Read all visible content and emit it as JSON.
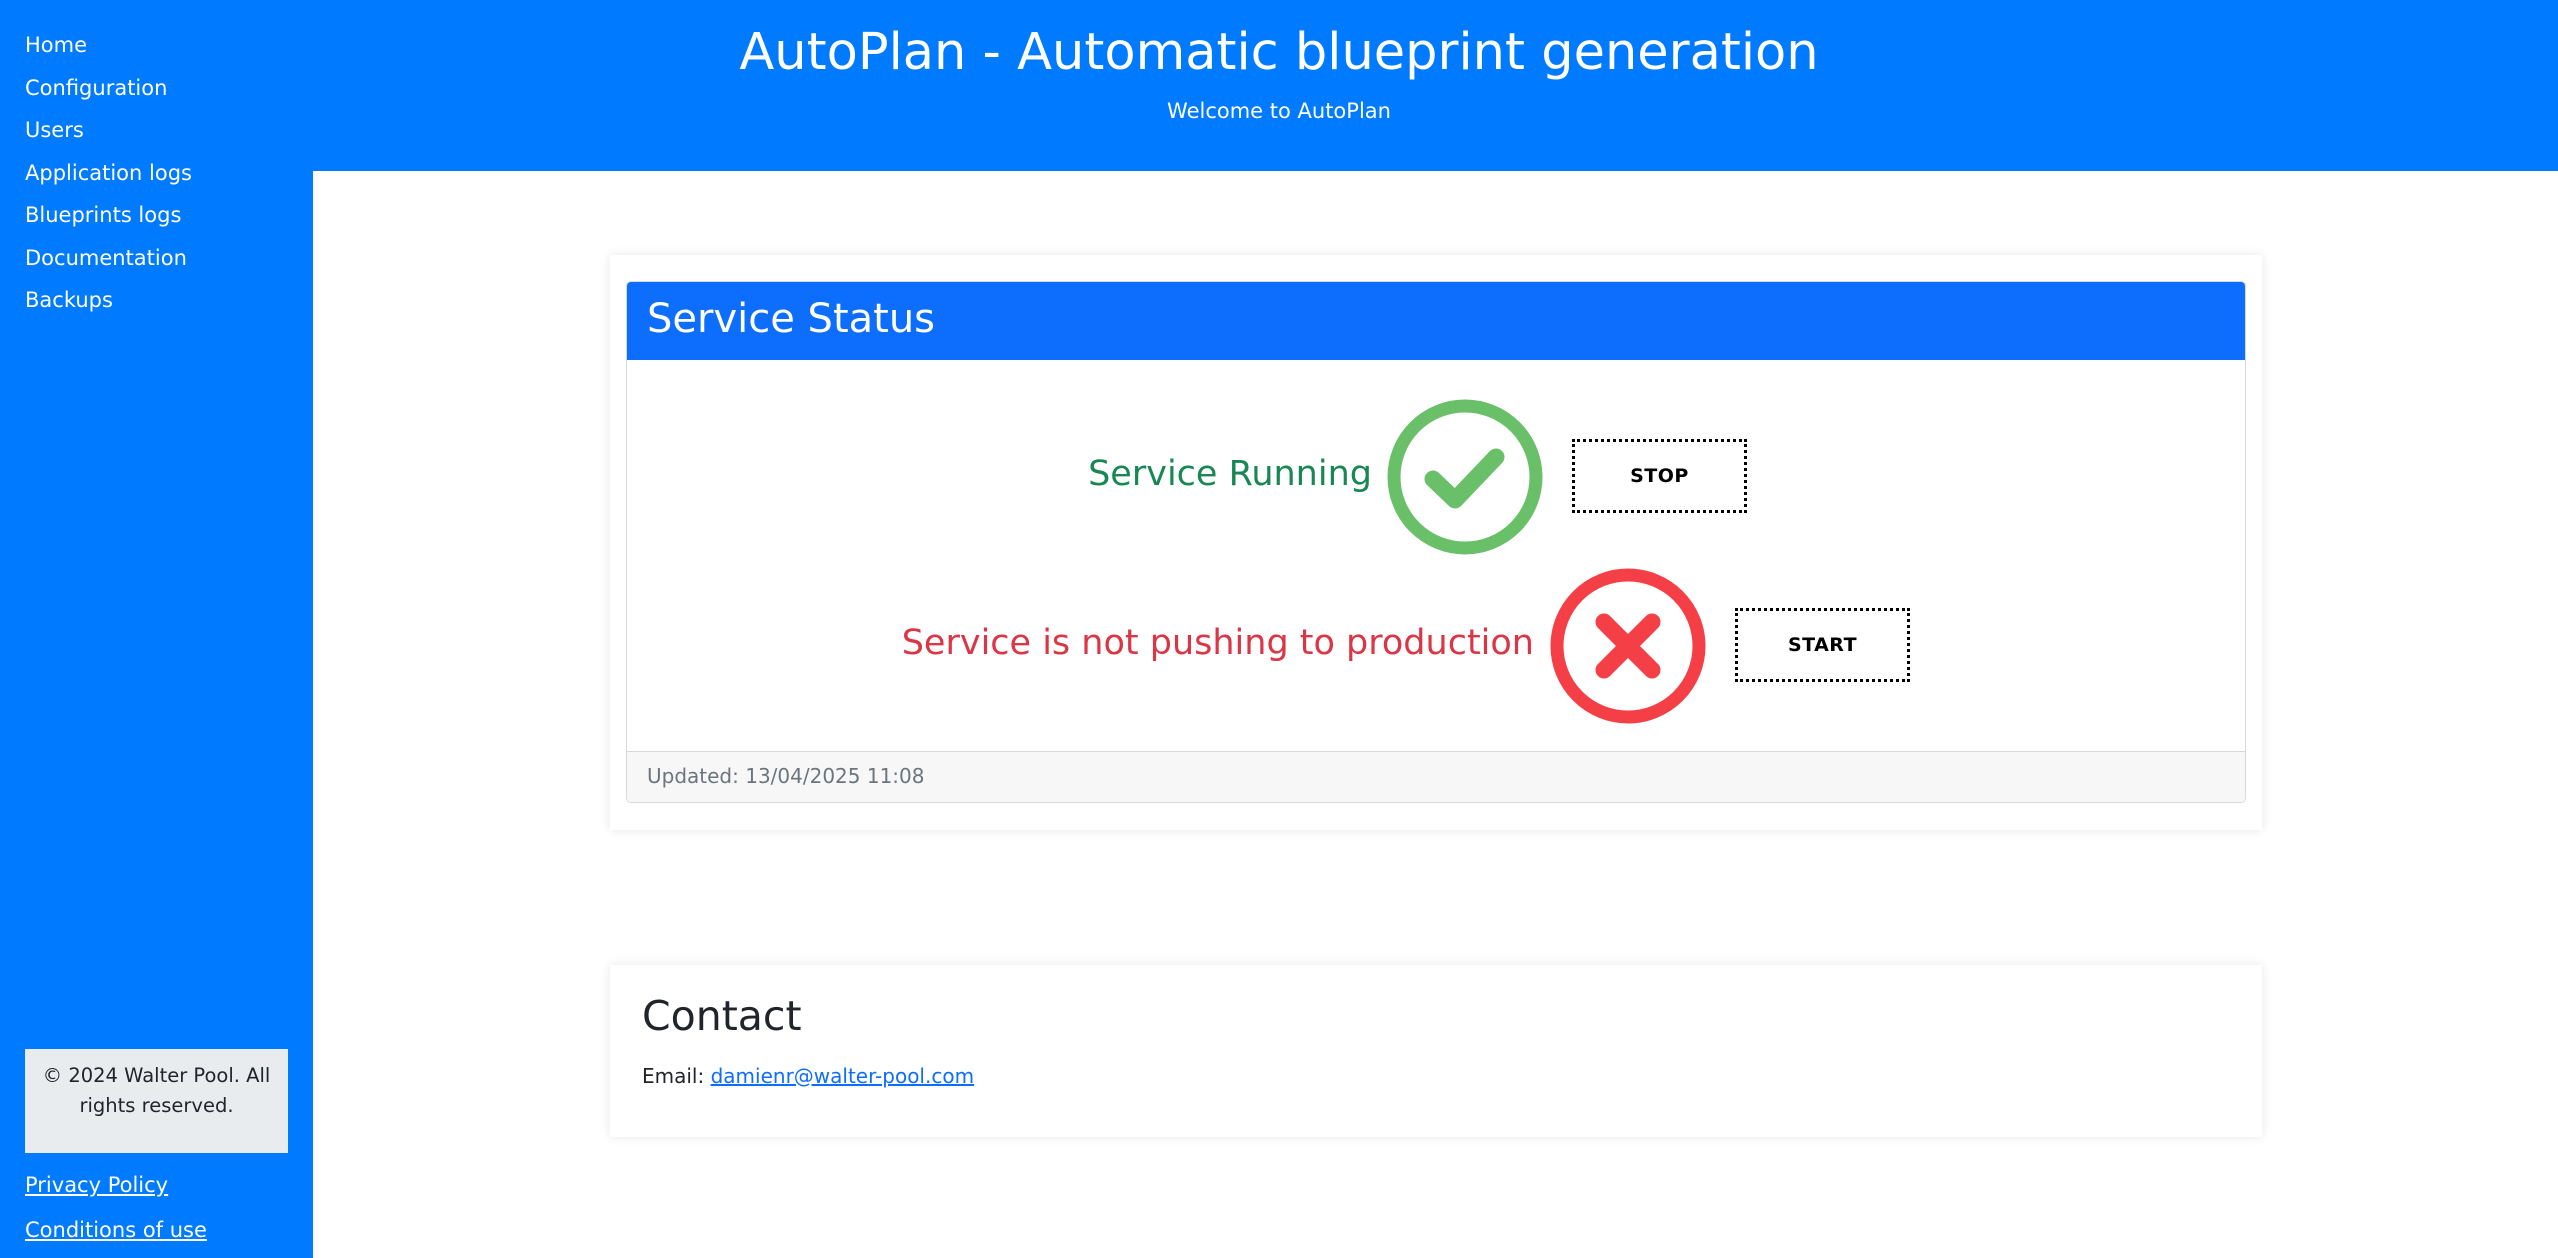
{
  "sidebar": {
    "nav": [
      "Home",
      "Configuration",
      "Users",
      "Application logs",
      "Blueprints logs",
      "Documentation",
      "Backups"
    ],
    "copyright": "© 2024 Walter Pool. All rights reserved.",
    "footer_links": [
      "Privacy Policy",
      "Conditions of use"
    ]
  },
  "header": {
    "title": "AutoPlan - Automatic blueprint generation",
    "subtitle": "Welcome to AutoPlan"
  },
  "status_card": {
    "title": "Service Status",
    "running": {
      "text": "Service Running",
      "icon": "check-circle-icon",
      "button": "STOP"
    },
    "production": {
      "text": "Service is not pushing to production",
      "icon": "x-circle-icon",
      "button": "START"
    },
    "updated": "Updated: 13/04/2025 11:08"
  },
  "contact": {
    "title": "Contact",
    "email_label": "Email:",
    "email": "damienr@walter-pool.com"
  },
  "colors": {
    "primary": "#007bff",
    "card_header": "#0d6efd",
    "success": "#198754",
    "success_icon": "#6abf69",
    "danger": "#dc3545",
    "danger_icon": "#f43f46"
  }
}
